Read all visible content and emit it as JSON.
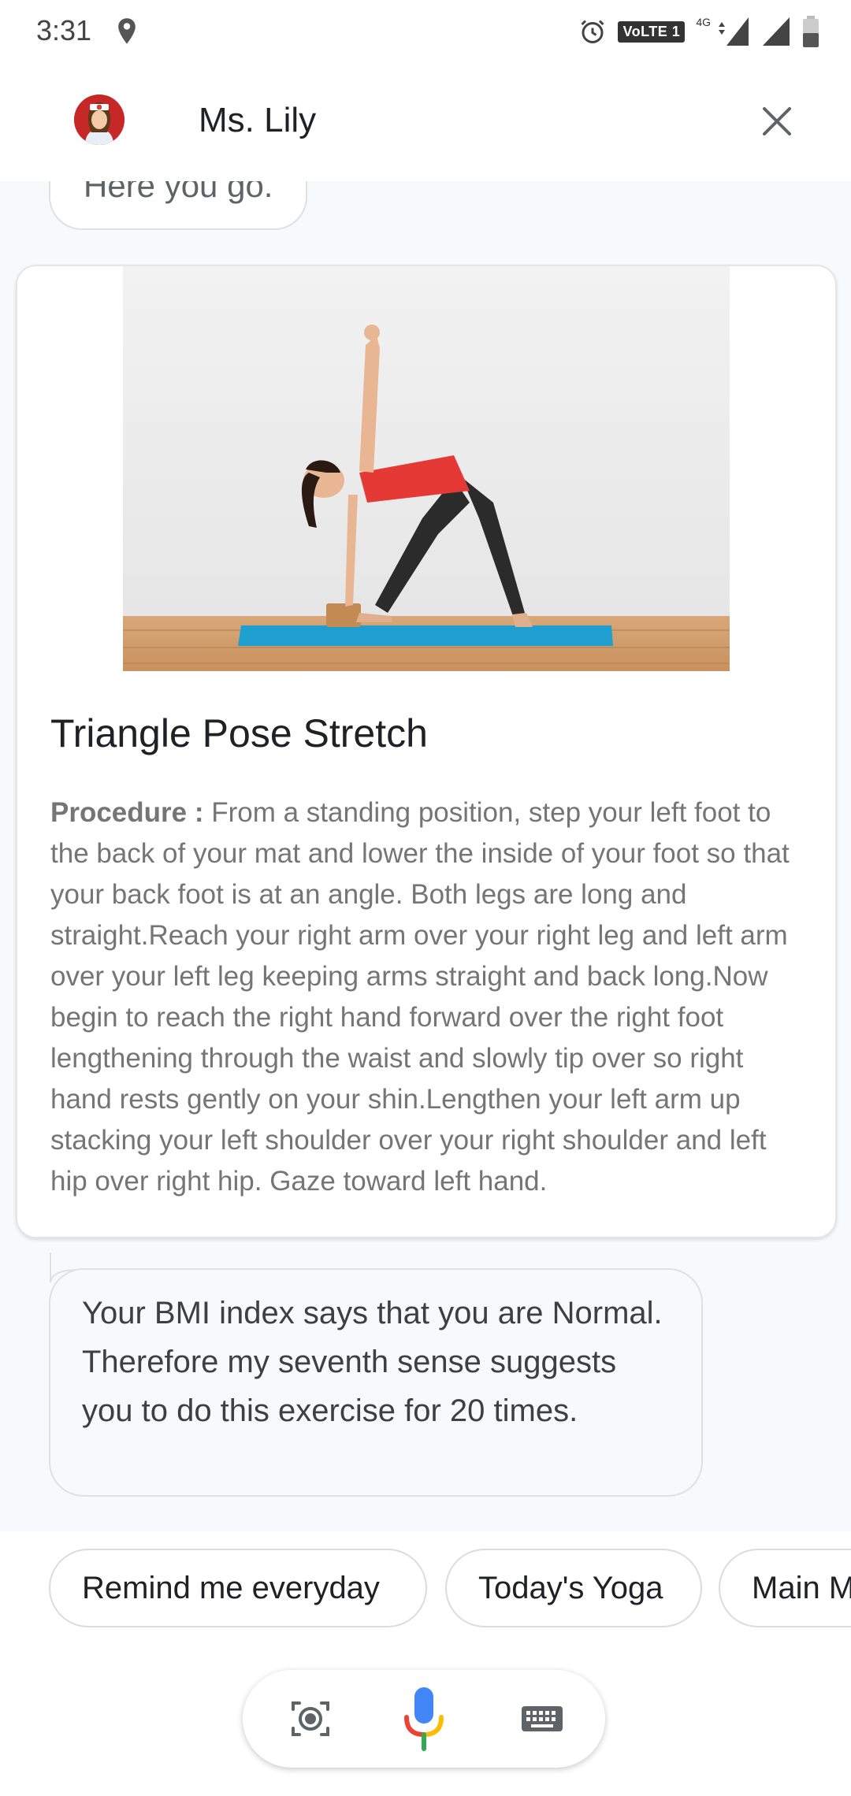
{
  "status_bar": {
    "time": "3:31",
    "volte": "VoLTE 1",
    "network": "4G",
    "icons": [
      "location-icon",
      "alarm-icon",
      "signal-icon",
      "battery-icon"
    ]
  },
  "header": {
    "agent_name": "Ms. Lily",
    "close_icon": "close-icon"
  },
  "conversation": {
    "greeting": "Here you go.",
    "card": {
      "title": "Triangle Pose Stretch",
      "procedure_label": "Procedure :",
      "procedure_text": " From a standing position, step your left foot to the back of your mat and lower the inside of your foot so that your back foot is at an angle. Both legs are long and straight.Reach your right arm over your right leg and left arm over your left leg keeping arms straight and back long.Now begin to reach the right hand forward over the right foot lengthening through the waist and slowly tip over so right hand rests gently on your shin.Lengthen your left arm up stacking your left shoulder over your right shoulder and left hip over right hip. Gaze toward left hand."
    },
    "bmi_message": "Your BMI index says that you are Normal. Therefore my seventh sense suggests you to do this exercise for 20 times."
  },
  "suggestions": [
    "Remind me everyday",
    "Today's Yoga",
    "Main M"
  ],
  "input_bar": {
    "icons": [
      "lens-icon",
      "microphone-icon",
      "keyboard-icon"
    ]
  },
  "colors": {
    "mic_blue": "#4285F4",
    "mic_red": "#EA4335",
    "mic_yellow": "#FBBC05",
    "mic_green": "#34A853",
    "mat_blue": "#1e9fd0",
    "top_red": "#e53935"
  }
}
